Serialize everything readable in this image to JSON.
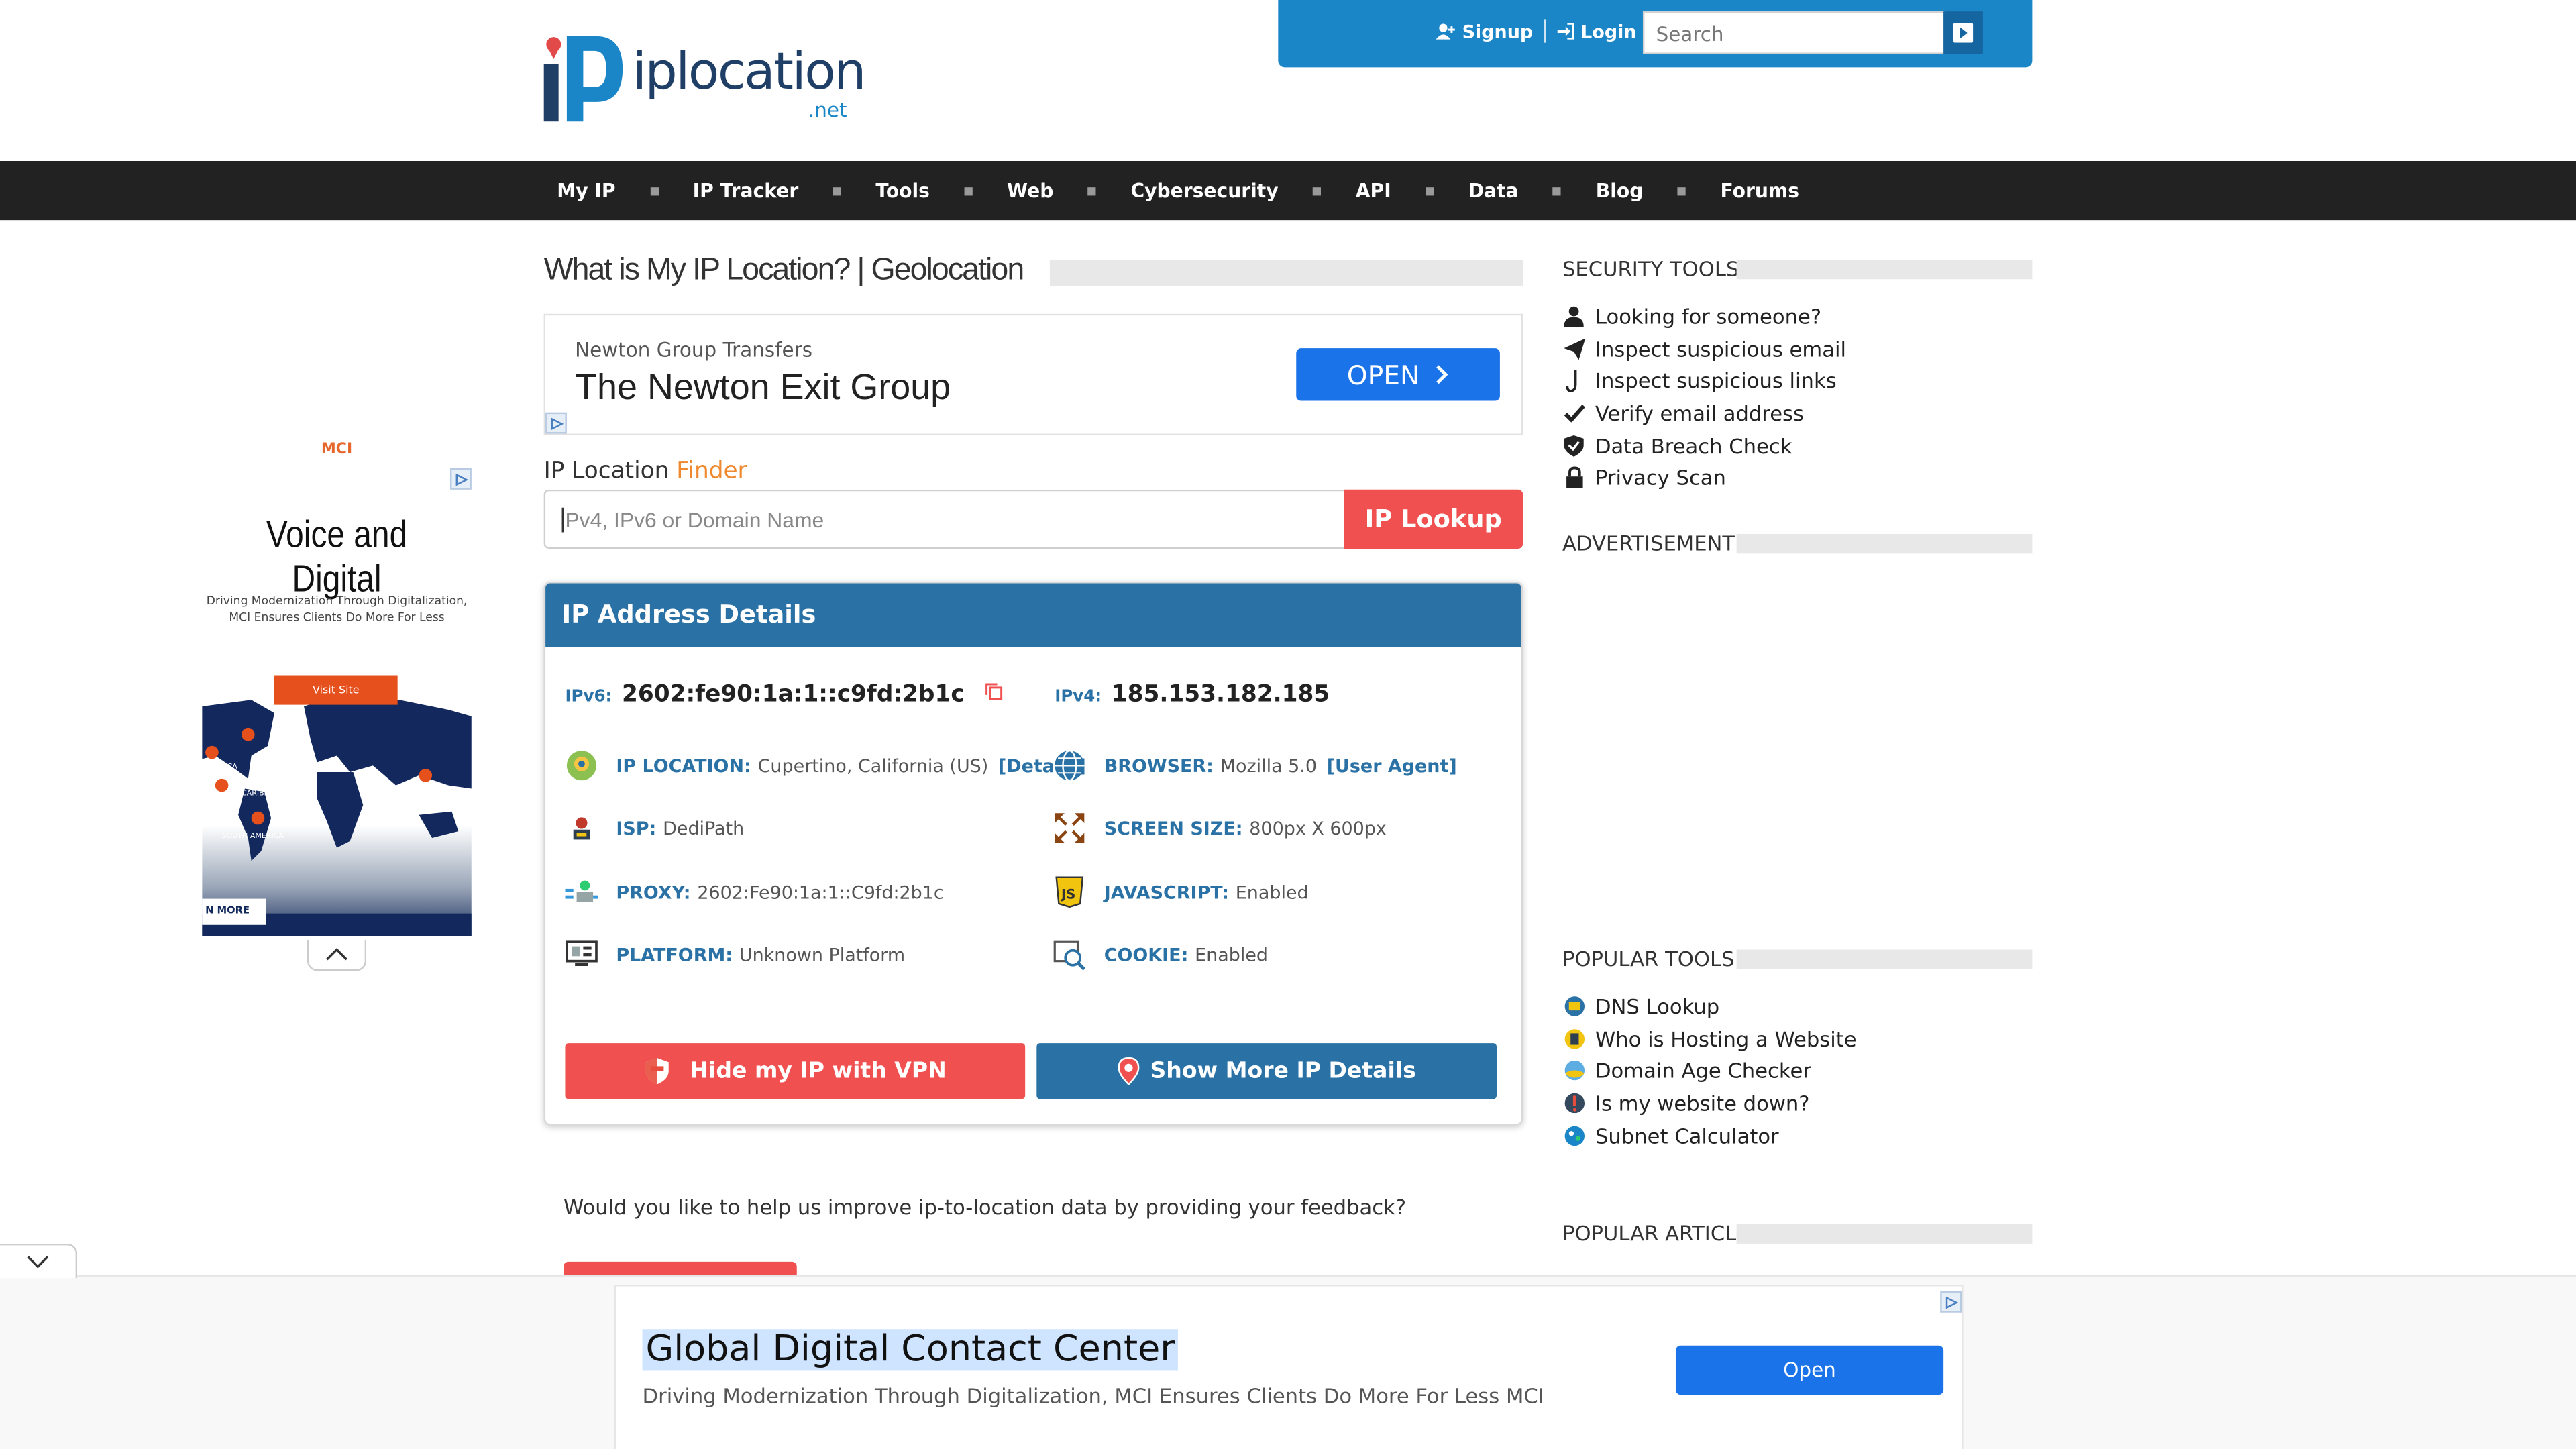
{
  "header": {
    "signup_label": "Signup",
    "login_label": "Login",
    "search_placeholder": "Search",
    "logo_text": "iplocation",
    "logo_suffix": ".net"
  },
  "nav": {
    "items": [
      "My IP",
      "IP Tracker",
      "Tools",
      "Web",
      "Cybersecurity",
      "API",
      "Data",
      "Blog",
      "Forums"
    ]
  },
  "main": {
    "title": "What is My IP Location? | Geolocation",
    "top_ad": {
      "advertiser": "Newton Group Transfers",
      "headline": "The Newton Exit Group",
      "button": "OPEN"
    },
    "finder": {
      "label": "IP Location",
      "label_accent": "Finder",
      "placeholder": "Pv4, IPv6 or Domain Name",
      "button": "IP Lookup"
    },
    "details": {
      "heading": "IP Address Details",
      "ipv6_label": "IPv6:",
      "ipv6": "2602:fe90:1a:1::c9fd:2b1c",
      "ipv4_label": "IPv4:",
      "ipv4": "185.153.182.185",
      "location_key": "IP LOCATION:",
      "location_val": "Cupertino, California (US)",
      "location_link": "[Details]",
      "isp_key": "ISP:",
      "isp_val": "DediPath",
      "proxy_key": "PROXY:",
      "proxy_val": "2602:Fe90:1a:1::C9fd:2b1c",
      "platform_key": "PLATFORM:",
      "platform_val": "Unknown Platform",
      "browser_key": "BROWSER:",
      "browser_val": "Mozilla 5.0",
      "browser_link": "[User Agent]",
      "screen_key": "SCREEN SIZE:",
      "screen_val": "800px X 600px",
      "js_key": "JAVASCRIPT:",
      "js_val": "Enabled",
      "cookie_key": "COOKIE:",
      "cookie_val": "Enabled",
      "vpn_button": "Hide my IP with VPN",
      "more_button": "Show More IP Details"
    },
    "feedback": "Would you like to help us improve ip-to-location data by providing your feedback?"
  },
  "sidebar": {
    "security_heading": "SECURITY TOOLS",
    "security_items": [
      "Looking for someone?",
      "Inspect suspicious email",
      "Inspect suspicious links",
      "Verify email address",
      "Data Breach Check",
      "Privacy Scan"
    ],
    "ad_heading": "ADVERTISEMENT",
    "popular_heading": "POPULAR TOOLS",
    "popular_items": [
      "DNS Lookup",
      "Who is Hosting a Website",
      "Domain Age Checker",
      "Is my website down?",
      "Subnet Calculator"
    ],
    "articles_heading": "POPULAR ARTICLES"
  },
  "left_ad": {
    "brand": "MCI",
    "title": "Voice and Digital",
    "subtitle": "Driving Modernization Through Digitalization, MCI Ensures Clients Do More For Less",
    "visit": "Visit Site",
    "learn": "N MORE"
  },
  "bottom_ad": {
    "title": "Global Digital Contact Center",
    "subtitle": "Driving Modernization Through Digitalization, MCI Ensures Clients Do More For Less MCI",
    "button": "Open"
  },
  "colors": {
    "brand_blue": "#1b86c7",
    "card_blue": "#2a71a5",
    "accent_red": "#f05050",
    "nav_bg": "#222222",
    "finder_accent": "#f0882d"
  }
}
